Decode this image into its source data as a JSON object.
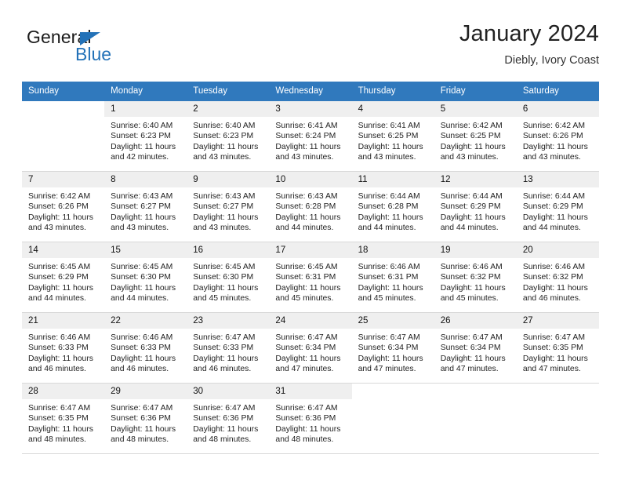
{
  "brand": {
    "name_top": "General",
    "name_bottom": "Blue",
    "triangle_icon": "triangle-icon",
    "color_blue": "#2372b8",
    "color_dark": "#1a1a1a"
  },
  "header": {
    "title": "January 2024",
    "subtitle": "Diebly, Ivory Coast"
  },
  "calendar": {
    "header_bg": "#3079bd",
    "datenum_bg": "#efefef",
    "weekdays": [
      "Sunday",
      "Monday",
      "Tuesday",
      "Wednesday",
      "Thursday",
      "Friday",
      "Saturday"
    ],
    "weeks": [
      [
        {
          "date": "",
          "sunrise": "",
          "sunset": "",
          "daylight": "",
          "empty": true
        },
        {
          "date": "1",
          "sunrise": "Sunrise: 6:40 AM",
          "sunset": "Sunset: 6:23 PM",
          "daylight": "Daylight: 11 hours and 42 minutes."
        },
        {
          "date": "2",
          "sunrise": "Sunrise: 6:40 AM",
          "sunset": "Sunset: 6:23 PM",
          "daylight": "Daylight: 11 hours and 43 minutes."
        },
        {
          "date": "3",
          "sunrise": "Sunrise: 6:41 AM",
          "sunset": "Sunset: 6:24 PM",
          "daylight": "Daylight: 11 hours and 43 minutes."
        },
        {
          "date": "4",
          "sunrise": "Sunrise: 6:41 AM",
          "sunset": "Sunset: 6:25 PM",
          "daylight": "Daylight: 11 hours and 43 minutes."
        },
        {
          "date": "5",
          "sunrise": "Sunrise: 6:42 AM",
          "sunset": "Sunset: 6:25 PM",
          "daylight": "Daylight: 11 hours and 43 minutes."
        },
        {
          "date": "6",
          "sunrise": "Sunrise: 6:42 AM",
          "sunset": "Sunset: 6:26 PM",
          "daylight": "Daylight: 11 hours and 43 minutes."
        }
      ],
      [
        {
          "date": "7",
          "sunrise": "Sunrise: 6:42 AM",
          "sunset": "Sunset: 6:26 PM",
          "daylight": "Daylight: 11 hours and 43 minutes."
        },
        {
          "date": "8",
          "sunrise": "Sunrise: 6:43 AM",
          "sunset": "Sunset: 6:27 PM",
          "daylight": "Daylight: 11 hours and 43 minutes."
        },
        {
          "date": "9",
          "sunrise": "Sunrise: 6:43 AM",
          "sunset": "Sunset: 6:27 PM",
          "daylight": "Daylight: 11 hours and 43 minutes."
        },
        {
          "date": "10",
          "sunrise": "Sunrise: 6:43 AM",
          "sunset": "Sunset: 6:28 PM",
          "daylight": "Daylight: 11 hours and 44 minutes."
        },
        {
          "date": "11",
          "sunrise": "Sunrise: 6:44 AM",
          "sunset": "Sunset: 6:28 PM",
          "daylight": "Daylight: 11 hours and 44 minutes."
        },
        {
          "date": "12",
          "sunrise": "Sunrise: 6:44 AM",
          "sunset": "Sunset: 6:29 PM",
          "daylight": "Daylight: 11 hours and 44 minutes."
        },
        {
          "date": "13",
          "sunrise": "Sunrise: 6:44 AM",
          "sunset": "Sunset: 6:29 PM",
          "daylight": "Daylight: 11 hours and 44 minutes."
        }
      ],
      [
        {
          "date": "14",
          "sunrise": "Sunrise: 6:45 AM",
          "sunset": "Sunset: 6:29 PM",
          "daylight": "Daylight: 11 hours and 44 minutes."
        },
        {
          "date": "15",
          "sunrise": "Sunrise: 6:45 AM",
          "sunset": "Sunset: 6:30 PM",
          "daylight": "Daylight: 11 hours and 44 minutes."
        },
        {
          "date": "16",
          "sunrise": "Sunrise: 6:45 AM",
          "sunset": "Sunset: 6:30 PM",
          "daylight": "Daylight: 11 hours and 45 minutes."
        },
        {
          "date": "17",
          "sunrise": "Sunrise: 6:45 AM",
          "sunset": "Sunset: 6:31 PM",
          "daylight": "Daylight: 11 hours and 45 minutes."
        },
        {
          "date": "18",
          "sunrise": "Sunrise: 6:46 AM",
          "sunset": "Sunset: 6:31 PM",
          "daylight": "Daylight: 11 hours and 45 minutes."
        },
        {
          "date": "19",
          "sunrise": "Sunrise: 6:46 AM",
          "sunset": "Sunset: 6:32 PM",
          "daylight": "Daylight: 11 hours and 45 minutes."
        },
        {
          "date": "20",
          "sunrise": "Sunrise: 6:46 AM",
          "sunset": "Sunset: 6:32 PM",
          "daylight": "Daylight: 11 hours and 46 minutes."
        }
      ],
      [
        {
          "date": "21",
          "sunrise": "Sunrise: 6:46 AM",
          "sunset": "Sunset: 6:33 PM",
          "daylight": "Daylight: 11 hours and 46 minutes."
        },
        {
          "date": "22",
          "sunrise": "Sunrise: 6:46 AM",
          "sunset": "Sunset: 6:33 PM",
          "daylight": "Daylight: 11 hours and 46 minutes."
        },
        {
          "date": "23",
          "sunrise": "Sunrise: 6:47 AM",
          "sunset": "Sunset: 6:33 PM",
          "daylight": "Daylight: 11 hours and 46 minutes."
        },
        {
          "date": "24",
          "sunrise": "Sunrise: 6:47 AM",
          "sunset": "Sunset: 6:34 PM",
          "daylight": "Daylight: 11 hours and 47 minutes."
        },
        {
          "date": "25",
          "sunrise": "Sunrise: 6:47 AM",
          "sunset": "Sunset: 6:34 PM",
          "daylight": "Daylight: 11 hours and 47 minutes."
        },
        {
          "date": "26",
          "sunrise": "Sunrise: 6:47 AM",
          "sunset": "Sunset: 6:34 PM",
          "daylight": "Daylight: 11 hours and 47 minutes."
        },
        {
          "date": "27",
          "sunrise": "Sunrise: 6:47 AM",
          "sunset": "Sunset: 6:35 PM",
          "daylight": "Daylight: 11 hours and 47 minutes."
        }
      ],
      [
        {
          "date": "28",
          "sunrise": "Sunrise: 6:47 AM",
          "sunset": "Sunset: 6:35 PM",
          "daylight": "Daylight: 11 hours and 48 minutes."
        },
        {
          "date": "29",
          "sunrise": "Sunrise: 6:47 AM",
          "sunset": "Sunset: 6:36 PM",
          "daylight": "Daylight: 11 hours and 48 minutes."
        },
        {
          "date": "30",
          "sunrise": "Sunrise: 6:47 AM",
          "sunset": "Sunset: 6:36 PM",
          "daylight": "Daylight: 11 hours and 48 minutes."
        },
        {
          "date": "31",
          "sunrise": "Sunrise: 6:47 AM",
          "sunset": "Sunset: 6:36 PM",
          "daylight": "Daylight: 11 hours and 48 minutes."
        },
        {
          "date": "",
          "sunrise": "",
          "sunset": "",
          "daylight": "",
          "empty": true
        },
        {
          "date": "",
          "sunrise": "",
          "sunset": "",
          "daylight": "",
          "empty": true
        },
        {
          "date": "",
          "sunrise": "",
          "sunset": "",
          "daylight": "",
          "empty": true
        }
      ]
    ]
  }
}
